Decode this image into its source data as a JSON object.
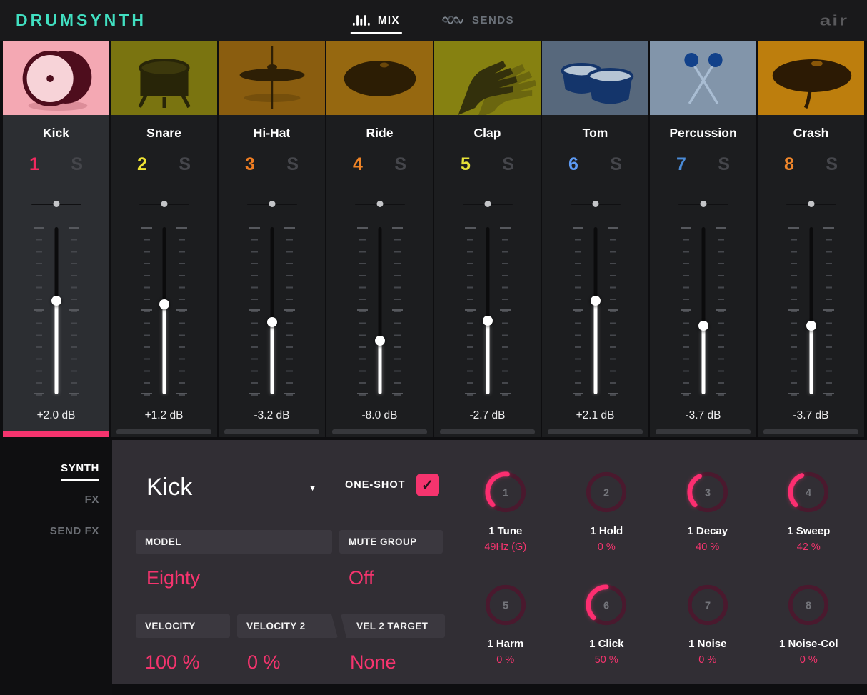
{
  "colors": {
    "teal": "#41dfc1",
    "accent": "#f5346e",
    "knob_track": "#4a192e",
    "knob_arc": "#fc2e70"
  },
  "header": {
    "logo": "DRUMSYNTH",
    "brand": "air",
    "tabs": [
      {
        "label": "MIX",
        "icon": "mixer-bars-icon",
        "active": true
      },
      {
        "label": "SENDS",
        "icon": "send-waves-icon",
        "active": false
      }
    ]
  },
  "channels": [
    {
      "name": "Kick",
      "number": "1",
      "number_color": "#f0295f",
      "solo_label": "S",
      "db": "+2.0 dB",
      "fader_pct": 44,
      "pan_pct": 50,
      "selected": true,
      "icon": "kick-drum",
      "thumb_bg": "#f4a8b3",
      "ink": "#4e0d1d",
      "ink2": "#f7d3d8"
    },
    {
      "name": "Snare",
      "number": "2",
      "number_color": "#eee233",
      "solo_label": "S",
      "db": "+1.2 dB",
      "fader_pct": 46,
      "pan_pct": 50,
      "selected": false,
      "icon": "snare-drum",
      "thumb_bg": "#7a7410",
      "ink": "#282508",
      "ink2": "#3c380c"
    },
    {
      "name": "Hi-Hat",
      "number": "3",
      "number_color": "#ee7d22",
      "solo_label": "S",
      "db": "-3.2 dB",
      "fader_pct": 57,
      "pan_pct": 50,
      "selected": false,
      "icon": "hihat-cymbal",
      "thumb_bg": "#8a5d0f",
      "ink": "#2e1f05",
      "ink2": "#3e2a07"
    },
    {
      "name": "Ride",
      "number": "4",
      "number_color": "#ee8326",
      "solo_label": "S",
      "db": "-8.0 dB",
      "fader_pct": 68,
      "pan_pct": 50,
      "selected": false,
      "icon": "ride-cymbal",
      "thumb_bg": "#966810",
      "ink": "#2c1d04",
      "ink2": "#6b4709"
    },
    {
      "name": "Clap",
      "number": "5",
      "number_color": "#e7e238",
      "solo_label": "S",
      "db": "-2.7 dB",
      "fader_pct": 56,
      "pan_pct": 50,
      "selected": false,
      "icon": "clap-hands",
      "thumb_bg": "#868111",
      "ink": "#33300c",
      "ink2": "#44400e"
    },
    {
      "name": "Tom",
      "number": "6",
      "number_color": "#5d9af3",
      "solo_label": "S",
      "db": "+2.1 dB",
      "fader_pct": 44,
      "pan_pct": 50,
      "selected": false,
      "icon": "tom-drums",
      "thumb_bg": "#57687c",
      "ink": "#14356b",
      "ink2": "#b6c5d4"
    },
    {
      "name": "Percussion",
      "number": "7",
      "number_color": "#4a8bd7",
      "solo_label": "S",
      "db": "-3.7 dB",
      "fader_pct": 59,
      "pan_pct": 50,
      "selected": false,
      "icon": "mallets",
      "thumb_bg": "#8295aa",
      "ink": "#12418a",
      "ink2": "#a9bdd3"
    },
    {
      "name": "Crash",
      "number": "8",
      "number_color": "#ef862b",
      "solo_label": "S",
      "db": "-3.7 dB",
      "fader_pct": 59,
      "pan_pct": 50,
      "selected": false,
      "icon": "crash-cymbal",
      "thumb_bg": "#bd7e0d",
      "ink": "#2c1a04",
      "ink2": "#8a5708"
    }
  ],
  "side_tabs": [
    {
      "label": "SYNTH",
      "active": true
    },
    {
      "label": "FX",
      "active": false
    },
    {
      "label": "SEND FX",
      "active": false
    }
  ],
  "panel": {
    "preset": "Kick",
    "oneshot": {
      "label": "ONE-SHOT",
      "checked": true
    },
    "fields": [
      {
        "label": "MODEL",
        "value": "Eighty"
      },
      {
        "label": "MUTE GROUP",
        "value": "Off"
      }
    ],
    "velocity_fields": [
      {
        "label": "VELOCITY",
        "value": "100 %"
      },
      {
        "label": "VELOCITY 2",
        "value": "0 %"
      },
      {
        "label": "VEL 2 TARGET",
        "value": "None"
      }
    ],
    "knobs": [
      {
        "num": "1",
        "label": "1 Tune",
        "value": "49Hz (G)",
        "pct": 52
      },
      {
        "num": "2",
        "label": "1 Hold",
        "value": "0 %",
        "pct": 0
      },
      {
        "num": "3",
        "label": "1 Decay",
        "value": "40 %",
        "pct": 40
      },
      {
        "num": "4",
        "label": "1 Sweep",
        "value": "42 %",
        "pct": 42
      },
      {
        "num": "5",
        "label": "1 Harm",
        "value": "0 %",
        "pct": 0
      },
      {
        "num": "6",
        "label": "1 Click",
        "value": "50 %",
        "pct": 50
      },
      {
        "num": "7",
        "label": "1 Noise",
        "value": "0 %",
        "pct": 0
      },
      {
        "num": "8",
        "label": "1 Noise-Col",
        "value": "0 %",
        "pct": 0
      }
    ]
  }
}
